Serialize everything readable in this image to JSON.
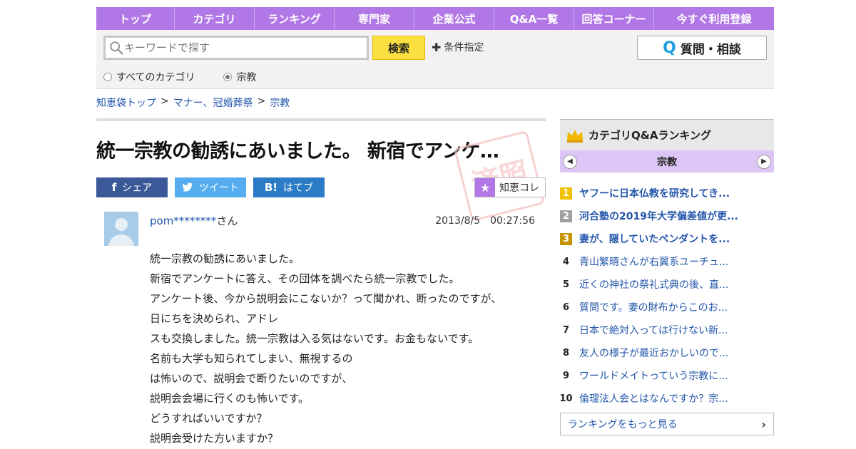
{
  "nav": [
    "トップ",
    "カテゴリ",
    "ランキング",
    "専門家",
    "企業公式",
    "Q&A一覧",
    "回答コーナー",
    "今すぐ利用登録"
  ],
  "search": {
    "placeholder": "キーワードで探す",
    "button": "検索",
    "condition": "条件指定",
    "ask_button": "質問・相談",
    "radio_all": "すべてのカテゴリ",
    "radio_current": "宗教",
    "selected": "宗教"
  },
  "breadcrumb": [
    "知恵袋トップ",
    "マナー、冠婚葬祭",
    "宗教"
  ],
  "question": {
    "title": "統一宗教の勧誘にあいました。 新宿でアンケ…",
    "stamp_text": "済照",
    "share": {
      "facebook": "シェア",
      "twitter": "ツイート",
      "hatena": "はてブ",
      "chie_coll": "知恵コレ"
    },
    "user": "pom********",
    "user_suffix": "さん",
    "date": "2013/8/5　00:27:56",
    "body": [
      "統一宗教の勧誘にあいました。",
      "新宿でアンケートに答え、その団体を調べたら統一宗教でした。",
      "アンケート後、今から説明会にこないか？って聞かれ、断ったのですが、",
      "日にちを決められ、アドレ",
      "スも交換しました。統一宗教は入る気はないです。お金もないです。",
      "名前も大学も知られてしまい、無視するの",
      "は怖いので、説明会で断りたいのですが、",
      "説明会会場に行くのも怖いです。",
      "どうすればいいですか？",
      "説明会受けた方いますか？"
    ]
  },
  "ranking": {
    "header": "カテゴリQ&Aランキング",
    "category": "宗教",
    "items": [
      {
        "rank": "1",
        "text": "ヤフーに日本仏教を研究してき..."
      },
      {
        "rank": "2",
        "text": "河合塾の2019年大学偏差値が更..."
      },
      {
        "rank": "3",
        "text": "妻が、隠していたペンダントを..."
      },
      {
        "rank": "4",
        "text": "青山繁晴さんが右翼系ユーチュ..."
      },
      {
        "rank": "5",
        "text": "近くの神社の祭礼式典の後、直..."
      },
      {
        "rank": "6",
        "text": "質問です。妻の財布からこのお..."
      },
      {
        "rank": "7",
        "text": "日本で絶対入っては行けない新..."
      },
      {
        "rank": "8",
        "text": "友人の様子が最近おかしいので..."
      },
      {
        "rank": "9",
        "text": "ワールドメイトっていう宗教に..."
      },
      {
        "rank": "10",
        "text": "倫理法人会とはなんですか？宗..."
      }
    ],
    "more": "ランキングをもっと見る"
  },
  "colors": {
    "nav": "#b277e6",
    "search_button": "#fce040",
    "link": "#2255aa"
  }
}
